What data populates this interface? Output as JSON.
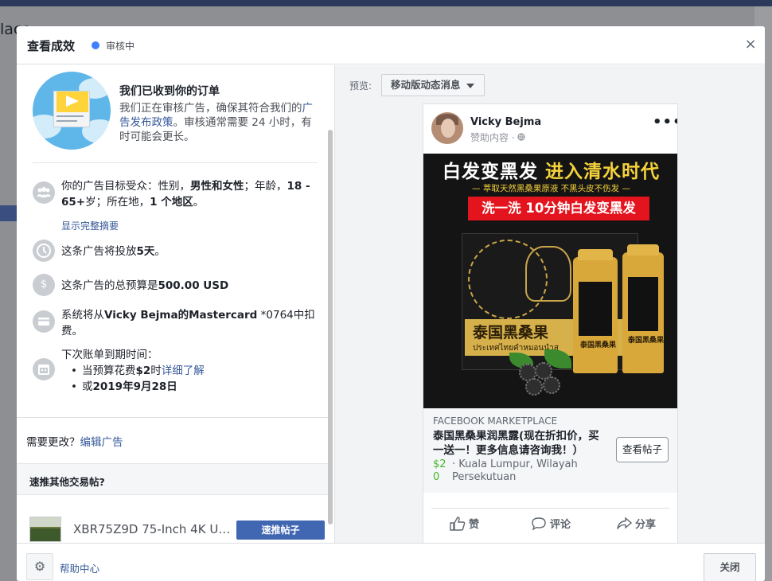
{
  "background": {
    "left_title": "lace"
  },
  "dialog": {
    "title": "查看成效",
    "status": "审核中",
    "close_symbol": "×"
  },
  "hero": {
    "title": "我们已收到你的订单",
    "desc_before": "我们正在审核广告，确保其符合我们的",
    "desc_link": "广告发布政策",
    "desc_after": "。审核通常需要 24 小时，有时可能会更长。"
  },
  "info": {
    "audience_prefix": "你的广告目标受众：性别，",
    "audience_gender": "男性和女性",
    "audience_mid": "；年龄，",
    "audience_age": "18 - 65+",
    "audience_mid2": "岁；所在地，",
    "audience_loc": "1 个地区",
    "audience_end": "。",
    "summary_link": "显示完整摘要",
    "duration_prefix": "这条广告将投放",
    "duration_value": "5天",
    "duration_end": "。",
    "budget_prefix": "这条广告的总预算是",
    "budget_value": "500.00 USD",
    "payment_prefix": "系统将从",
    "payment_value": "Vicky Bejma的Mastercard",
    "payment_card": " *0764",
    "payment_end": "中扣费。",
    "billing_head": "下次账单到期时间：",
    "billing_item1_prefix": "当预算花费",
    "billing_item1_value": "$2",
    "billing_item1_mid": "时",
    "billing_item1_link": "详细了解",
    "billing_item2_prefix": "或",
    "billing_item2_value": "2019年9月28日"
  },
  "edit": {
    "prefix": "需要更改？",
    "link": "编辑广告"
  },
  "boost": {
    "label": "速推其他交易帖?",
    "product_title": "XBR75Z9D 75-Inch 4K Ul...",
    "button": "速推帖子"
  },
  "preview": {
    "label": "预览:",
    "selected": "移动版动态消息"
  },
  "ad": {
    "name": "Vicky Bejma",
    "sponsored": "赞助内容 · ",
    "more": "•••",
    "headline_a": "白发变黑发",
    "headline_b": "进入清水时代",
    "subline": "— 萃取天然黑桑果原液 不黑头皮不伤发 —",
    "redbar": "洗一洗 10分钟白发变黑发",
    "box_name": "泰国黑桑果",
    "box_thai": "ประเทศไทยคำหมอนนำส",
    "bottle_text": "泰国黑桑果",
    "marketplace": "FACEBOOK MARKETPLACE",
    "title": "泰国黑桑果润黑露(现在折扣价，买一送一！更多信息请咨询我！）",
    "price_a": "$2",
    "price_b": "0",
    "location": "· Kuala Lumpur, Wilayah Persekutuan",
    "view_button": "查看帖子",
    "like": "赞",
    "comment": "评论",
    "share": "分享"
  },
  "footer": {
    "help": "帮助中心",
    "close": "关闭"
  },
  "colors": {
    "accent": "#4267b2",
    "link": "#365899",
    "status_dot": "#4080ff",
    "price": "#42b72a",
    "ad_red": "#e3141d",
    "ad_gold": "#d6b04a"
  },
  "icons": [
    "close-icon",
    "audience-icon",
    "clock-icon",
    "dollar-icon",
    "card-icon",
    "calendar-icon",
    "gear-icon",
    "like-icon",
    "comment-icon",
    "share-icon",
    "globe-icon",
    "more-icon",
    "caret-down-icon"
  ]
}
